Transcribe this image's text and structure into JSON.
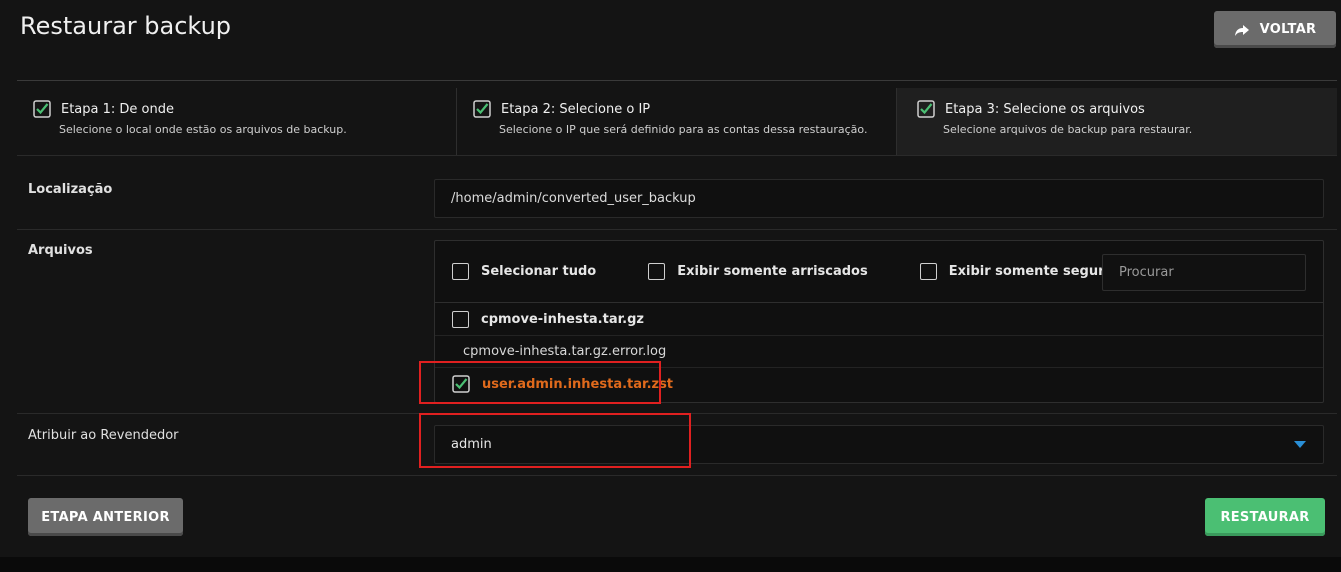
{
  "page": {
    "title": "Restaurar backup",
    "back_label": "VOLTAR"
  },
  "steps": [
    {
      "title": "Etapa 1: De onde",
      "subtitle": "Selecione o local onde estão os arquivos de backup."
    },
    {
      "title": "Etapa 2: Selecione o IP",
      "subtitle": "Selecione o IP que será definido para as contas dessa restauração."
    },
    {
      "title": "Etapa 3: Selecione os arquivos",
      "subtitle": "Selecione arquivos de backup para restaurar."
    }
  ],
  "location": {
    "label": "Localização",
    "value": "/home/admin/converted_user_backup"
  },
  "files": {
    "label": "Arquivos",
    "select_all": "Selecionar tudo",
    "only_risky": "Exibir somente arriscados",
    "only_safe": "Exibir somente seguros",
    "search_placeholder": "Procurar",
    "items": [
      {
        "name": "cpmove-inhesta.tar.gz",
        "checkbox": true,
        "checked": false
      },
      {
        "name": "cpmove-inhesta.tar.gz.error.log",
        "checkbox": false,
        "checked": false
      },
      {
        "name": "user.admin.inhesta.tar.zst",
        "checkbox": true,
        "checked": true
      }
    ]
  },
  "reseller": {
    "label": "Atribuir ao Revendedor",
    "value": "admin"
  },
  "actions": {
    "previous": "ETAPA ANTERIOR",
    "restore": "RESTAURAR"
  },
  "colors": {
    "accent_green": "#4bbf73",
    "selected_orange": "#e06a1c",
    "highlight_red": "#e02020",
    "caret_blue": "#2a8fd6"
  }
}
